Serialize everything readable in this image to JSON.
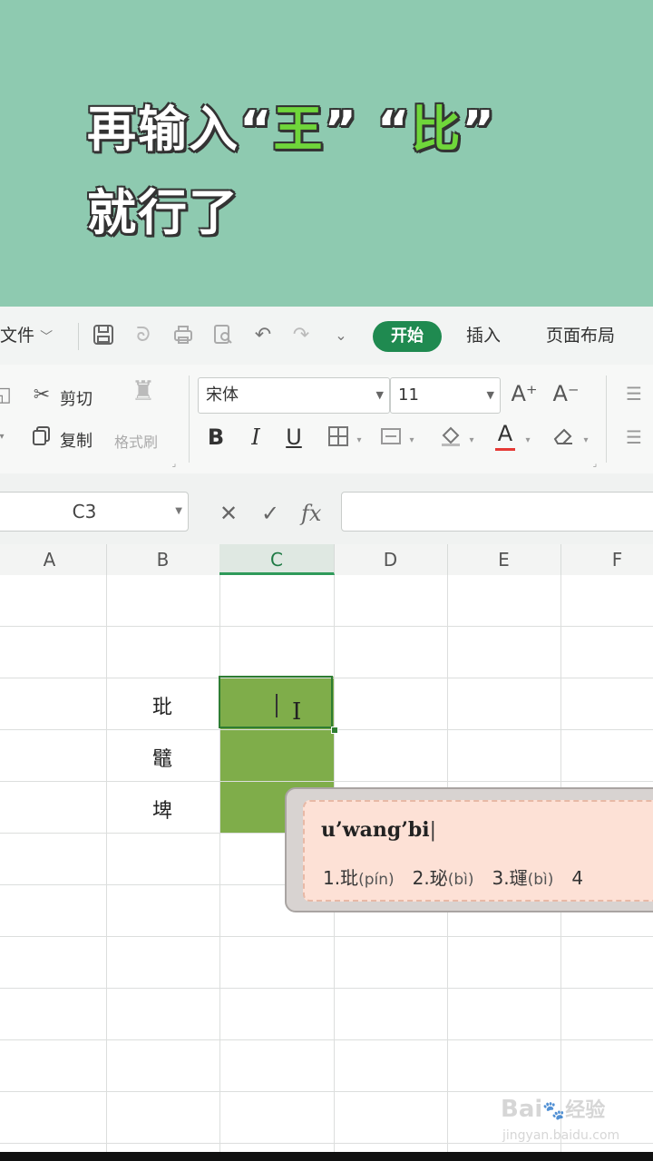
{
  "caption": {
    "line1_prefix": "再输入",
    "q1_open": "“",
    "q1_char": "王",
    "q1_close": "”",
    "q2_open": "“",
    "q2_char": "比",
    "q2_close": "”",
    "line2": "就行了",
    "highlight_color": "#6fd63a"
  },
  "quick_access": {
    "file_label": "文件",
    "active_tab": "开始",
    "tabs": [
      "插入",
      "页面布局"
    ]
  },
  "ribbon": {
    "cut_label": "剪切",
    "copy_label": "复制",
    "format_painter_label": "格式刷",
    "font_name": "宋体",
    "font_size": "11",
    "grow_font": "A⁺",
    "shrink_font": "A⁻",
    "bold": "B",
    "italic": "I",
    "underline": "U",
    "font_color_letter": "A"
  },
  "formula_bar": {
    "name_box": "C3",
    "cancel": "✕",
    "confirm": "✓",
    "fx": "fx",
    "content": ""
  },
  "columns": [
    "A",
    "B",
    "C",
    "D",
    "E",
    "F"
  ],
  "selected_column": "C",
  "cells": {
    "B3": "玭",
    "B4": "鼊",
    "B5": "埤"
  },
  "ime": {
    "input": "u’wang’bi",
    "candidates": [
      {
        "index": "1.",
        "char": "玭",
        "pinyin": "(pín)"
      },
      {
        "index": "2.",
        "char": "珌",
        "pinyin": "(bì)"
      },
      {
        "index": "3.",
        "char": "璭",
        "pinyin": "(bì)"
      },
      {
        "index": "4",
        "char": "",
        "pinyin": ""
      }
    ]
  },
  "watermark": {
    "brand": "Bai",
    "brand_cn": "经验",
    "url": "jingyan.baidu.com"
  }
}
